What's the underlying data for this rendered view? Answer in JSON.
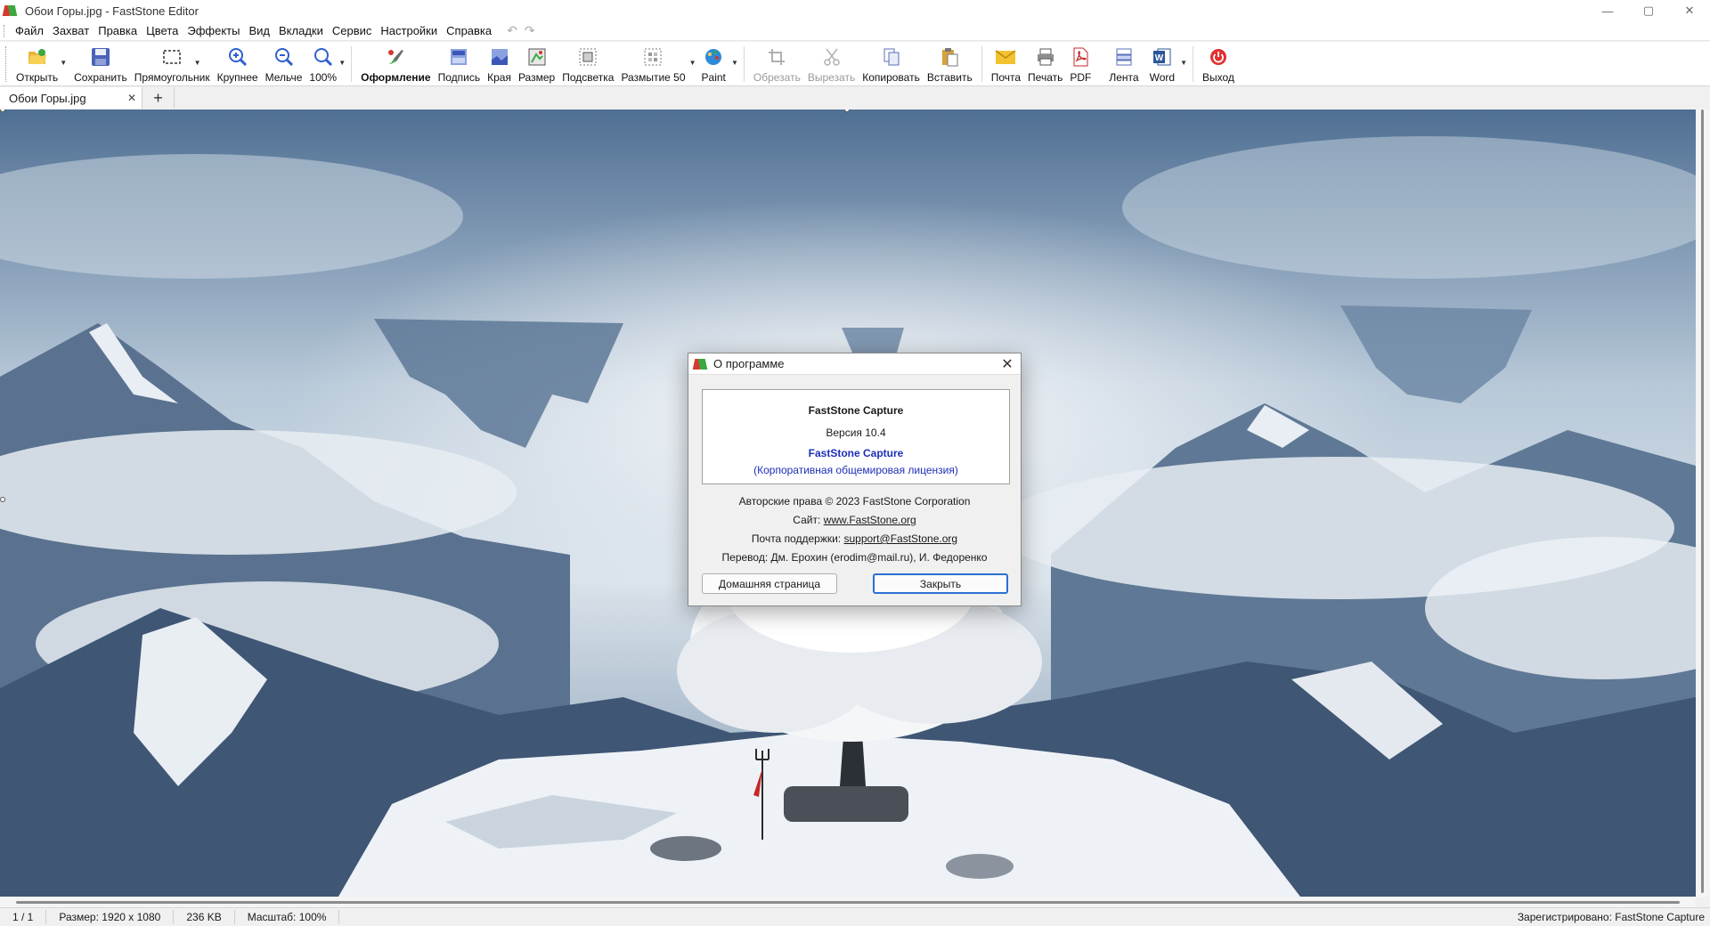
{
  "window": {
    "title": "Обои Горы.jpg - FastStone Editor",
    "controls": [
      "—",
      "▢",
      "✕"
    ]
  },
  "menu": [
    "Файл",
    "Захват",
    "Правка",
    "Цвета",
    "Эффекты",
    "Вид",
    "Вкладки",
    "Сервис",
    "Настройки",
    "Справка"
  ],
  "toolbar": {
    "open": "Открыть",
    "save": "Сохранить",
    "rect": "Прямоугольник",
    "zoom_in": "Крупнее",
    "zoom_out": "Мельче",
    "zoom_100": "100%",
    "decor": "Оформление",
    "caption": "Подпись",
    "edges": "Края",
    "resize": "Размер",
    "highlight": "Подсветка",
    "blur": "Размытие 50",
    "paint": "Paint",
    "crop": "Обрезать",
    "cut": "Вырезать",
    "copy": "Копировать",
    "paste": "Вставить",
    "mail": "Почта",
    "print": "Печать",
    "pdf": "PDF",
    "ribbon": "Лента",
    "word": "Word",
    "exit": "Выход"
  },
  "tabs": [
    {
      "label": "Обои Горы.jpg"
    }
  ],
  "tab_add": "+",
  "status": {
    "page": "1 / 1",
    "size": "Размер: 1920 x 1080",
    "filesize": "236 KB",
    "scale": "Масштаб: 100%",
    "registered": "Зарегистрировано: FastStone Capture"
  },
  "about": {
    "title": "О программе",
    "product": "FastStone Capture",
    "version": "Версия 10.4",
    "product2": "FastStone Capture",
    "license": "(Корпоративная общемировая лицензия)",
    "copyright": "Авторские права © 2023 FastStone Corporation",
    "site_label": "Сайт:",
    "site_url": "www.FastStone.org",
    "support_label": "Почта поддержки:",
    "support_email": "support@FastStone.org",
    "translation": "Перевод: Дм. Ерохин (erodim@mail.ru), И. Федоренко",
    "home_button": "Домашняя страница",
    "close_button": "Закрыть"
  },
  "colors": {
    "accent": "#2a6fd1",
    "link_blue": "#1d2fb8",
    "save_icon": "#4a63b8",
    "exit_icon": "#e03030"
  }
}
